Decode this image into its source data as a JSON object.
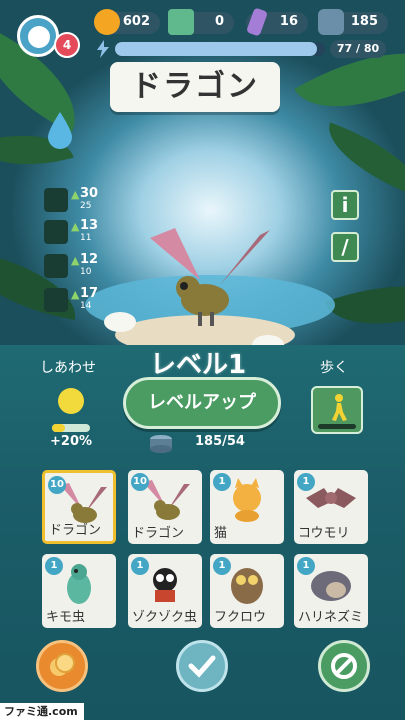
{
  "currencies": [
    {
      "name": "coin",
      "value": "602",
      "color": "#f4a623"
    },
    {
      "name": "ticket",
      "value": "0",
      "color": "#5fb98c"
    },
    {
      "name": "crystal",
      "value": "16",
      "color": "#a47ed6"
    },
    {
      "name": "food",
      "value": "185",
      "color": "#6b8fa8"
    }
  ],
  "profile": {
    "badge": "4"
  },
  "energy": {
    "label": "77 / 80",
    "fraction": 0.9625
  },
  "creature": {
    "name": "ドラゴン"
  },
  "stats": [
    {
      "icon": "bell-icon",
      "value": "30",
      "sub": "25"
    },
    {
      "icon": "runner-icon",
      "value": "13",
      "sub": "11"
    },
    {
      "icon": "lightning-icon",
      "value": "12",
      "sub": "10"
    },
    {
      "icon": "coins-icon",
      "value": "17",
      "sub": "14"
    }
  ],
  "side_buttons": {
    "info": "i",
    "edit": "/"
  },
  "happiness": {
    "label": "しあわせ",
    "percent": "+20%",
    "fill": 0.35
  },
  "level": {
    "label": "レベル1",
    "button": "レベルアップ",
    "food_count": "185/54"
  },
  "walk": {
    "label": "歩く"
  },
  "cards": [
    {
      "level": "10",
      "name": "ドラゴン",
      "selected": true,
      "kind": "dragon"
    },
    {
      "level": "10",
      "name": "ドラゴン",
      "selected": false,
      "kind": "dragon"
    },
    {
      "level": "1",
      "name": "猫",
      "selected": false,
      "kind": "cat"
    },
    {
      "level": "1",
      "name": "コウモリ",
      "selected": false,
      "kind": "bat"
    },
    {
      "level": "1",
      "name": "キモ虫",
      "selected": false,
      "kind": "bug"
    },
    {
      "level": "1",
      "name": "ゾクゾク虫",
      "selected": false,
      "kind": "beetle"
    },
    {
      "level": "1",
      "name": "フクロウ",
      "selected": false,
      "kind": "owl"
    },
    {
      "level": "1",
      "name": "ハリネズミ",
      "selected": false,
      "kind": "hedgehog"
    }
  ],
  "watermark": "ファミ通.com",
  "colors": {
    "accent_green": "#4a9c62",
    "selected_card": "#f0bf2e",
    "level_badge": "#43a6c4"
  }
}
